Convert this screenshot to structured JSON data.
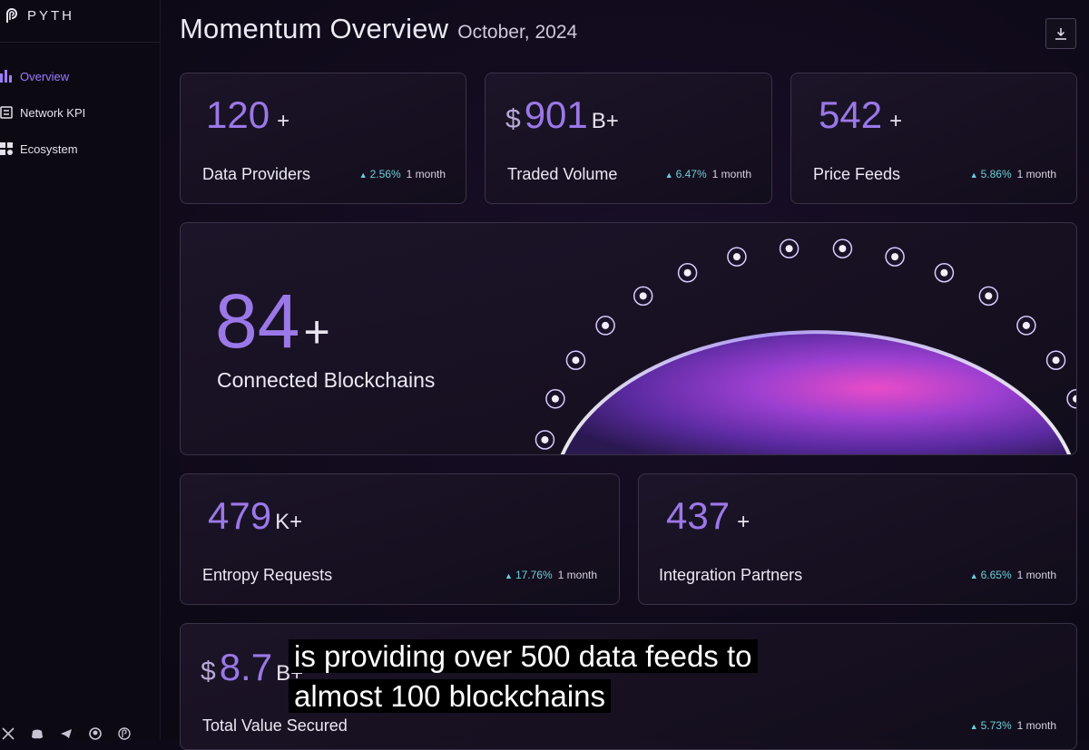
{
  "brand": {
    "name": "PYTH"
  },
  "sidebar": {
    "items": [
      {
        "label": "Overview",
        "icon": "bar-chart-icon",
        "active": true
      },
      {
        "label": "Network KPI",
        "icon": "document-icon",
        "active": false
      },
      {
        "label": "Ecosystem",
        "icon": "grid-icon",
        "active": false
      }
    ],
    "social_icons": [
      "x-icon",
      "discord-icon",
      "telegram-icon",
      "github-icon",
      "pyth-icon"
    ]
  },
  "header": {
    "title": "Momentum Overview",
    "date": "October, 2024"
  },
  "toolbar": {
    "download_icon": "download-icon"
  },
  "metrics": [
    {
      "id": "data-providers",
      "prefix": "",
      "value": "120",
      "suffix": "+",
      "label": "Data Providers",
      "change": "2.56%",
      "period": "1 month"
    },
    {
      "id": "traded-volume",
      "prefix": "$",
      "value": "901",
      "suffix": "B+",
      "label": "Traded Volume",
      "change": "6.47%",
      "period": "1 month"
    },
    {
      "id": "price-feeds",
      "prefix": "",
      "value": "542",
      "suffix": "+",
      "label": "Price Feeds",
      "change": "5.86%",
      "period": "1 month"
    },
    {
      "id": "entropy-requests",
      "prefix": "",
      "value": "479",
      "suffix": "K+",
      "label": "Entropy Requests",
      "change": "17.76%",
      "period": "1 month"
    },
    {
      "id": "integration-partners",
      "prefix": "",
      "value": "437",
      "suffix": "+",
      "label": "Integration Partners",
      "change": "6.65%",
      "period": "1 month"
    },
    {
      "id": "total-value-secured",
      "prefix": "$",
      "value": "8.7",
      "suffix": "B+",
      "label": "Total Value Secured",
      "change": "5.73%",
      "period": "1 month"
    }
  ],
  "blockchains": {
    "value": "84",
    "suffix": "+",
    "label": "Connected Blockchains",
    "chain_count": 16
  },
  "caption": {
    "line1": "is providing over 500 data feeds to",
    "line2": "almost 100 blockchains"
  },
  "colors": {
    "accent": "#9b78e8",
    "up": "#6ed0d9",
    "border": "#3a3247"
  }
}
